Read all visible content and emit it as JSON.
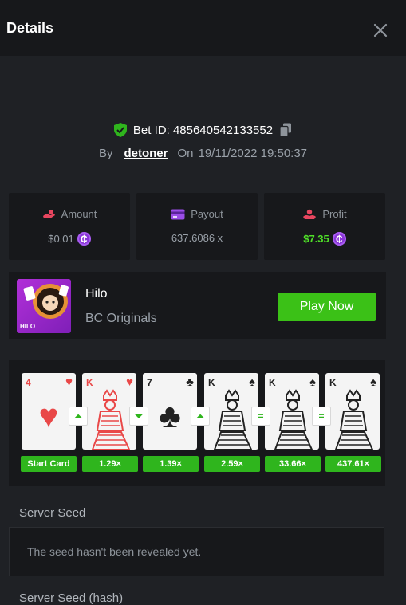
{
  "header": {
    "title": "Details"
  },
  "bet": {
    "id_label": "Bet ID: 485640542133552",
    "by_label": "By",
    "user": "detoner",
    "on_label": "On",
    "datetime": "19/11/2022 19:50:37"
  },
  "stats": {
    "amount": {
      "label": "Amount",
      "value": "$0.01"
    },
    "payout": {
      "label": "Payout",
      "value": "637.6086 x"
    },
    "profit": {
      "label": "Profit",
      "value": "$7.35"
    }
  },
  "game": {
    "name": "Hilo",
    "provider": "BC Originals",
    "thumb_label": "HILO",
    "play_label": "Play Now"
  },
  "cards": [
    {
      "rank": "4",
      "suit": "♥",
      "color": "#e94848",
      "multiplier": "Start Card"
    },
    {
      "rank": "K",
      "suit": "♥",
      "color": "#e94848",
      "multiplier": "1.29×"
    },
    {
      "rank": "7",
      "suit": "♣",
      "color": "#222222",
      "multiplier": "1.39×"
    },
    {
      "rank": "K",
      "suit": "♠",
      "color": "#222222",
      "multiplier": "2.59×"
    },
    {
      "rank": "K",
      "suit": "♠",
      "color": "#222222",
      "multiplier": "33.66×"
    },
    {
      "rank": "K",
      "suit": "♠",
      "color": "#222222",
      "multiplier": "437.61×"
    }
  ],
  "guesses": [
    "higher",
    "lower",
    "higher",
    "same",
    "same"
  ],
  "server_seed": {
    "label": "Server Seed",
    "message": "The seed hasn't been revealed yet."
  },
  "next_label": "Server Seed (hash)",
  "colors": {
    "accent_green": "#3bc117",
    "coin_purple": "#8a34d8",
    "panel": "#17181b",
    "background": "#1f2125"
  },
  "icons": [
    "close-icon",
    "shield-check-icon",
    "copy-icon",
    "amount-icon",
    "payout-icon",
    "profit-icon",
    "coin-icon"
  ]
}
